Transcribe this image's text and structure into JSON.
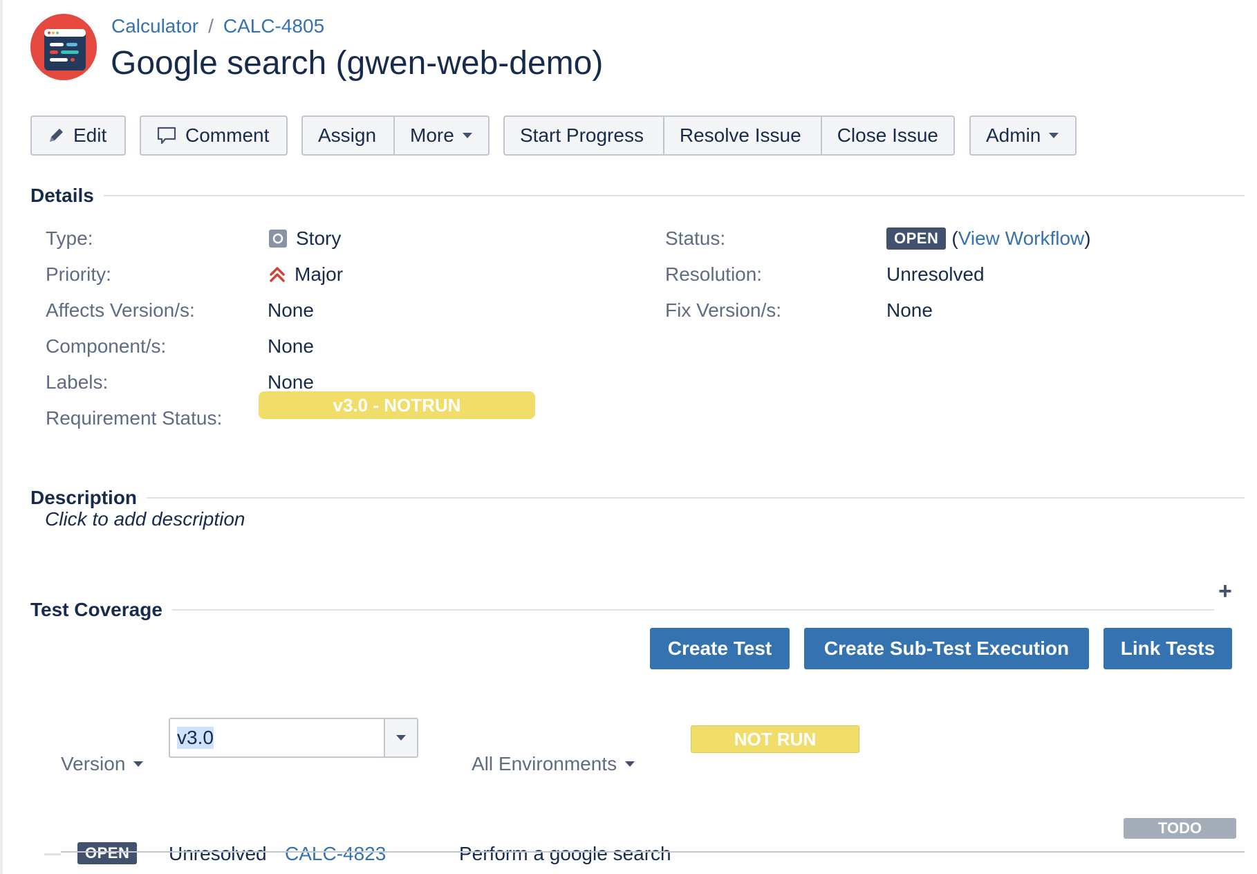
{
  "breadcrumb": {
    "project": "Calculator",
    "separator": "/",
    "issue_key": "CALC-4805"
  },
  "title": "Google search (gwen-web-demo)",
  "toolbar": {
    "edit": "Edit",
    "comment": "Comment",
    "assign": "Assign",
    "more": "More",
    "start_progress": "Start Progress",
    "resolve_issue": "Resolve Issue",
    "close_issue": "Close Issue",
    "admin": "Admin"
  },
  "details": {
    "heading": "Details",
    "type_label": "Type:",
    "type_value": "Story",
    "priority_label": "Priority:",
    "priority_value": "Major",
    "affects_label": "Affects Version/s:",
    "affects_value": "None",
    "components_label": "Component/s:",
    "components_value": "None",
    "labels_label": "Labels:",
    "labels_value": "None",
    "req_status_label": "Requirement Status:",
    "req_status_value": "v3.0 - NOTRUN",
    "status_label": "Status:",
    "status_value": "OPEN",
    "view_workflow_open": "(",
    "view_workflow": "View Workflow",
    "view_workflow_close": ")",
    "resolution_label": "Resolution:",
    "resolution_value": "Unresolved",
    "fix_label": "Fix Version/s:",
    "fix_value": "None"
  },
  "description": {
    "heading": "Description",
    "placeholder": "Click to add description"
  },
  "test_coverage": {
    "heading": "Test Coverage",
    "add_symbol": "+",
    "create_test": "Create Test",
    "create_sub_test_execution": "Create Sub-Test Execution",
    "link_tests": "Link Tests",
    "version_label": "Version",
    "version_value": "v3.0",
    "environments_label": "All Environments",
    "status_bar": "NOT RUN",
    "rows": [
      {
        "status": "OPEN",
        "resolution": "Unresolved",
        "key": "CALC-4823",
        "summary": "Perform a google search",
        "test_status": "TODO"
      }
    ]
  },
  "colors": {
    "link": "#3572b0",
    "primary_button": "#3572b0",
    "notrun_yellow": "#f0dd6a",
    "open_badge": "#42526e",
    "todo_gray": "#a5adba",
    "avatar_red": "#e5483e",
    "priority_major": "#d04437"
  }
}
